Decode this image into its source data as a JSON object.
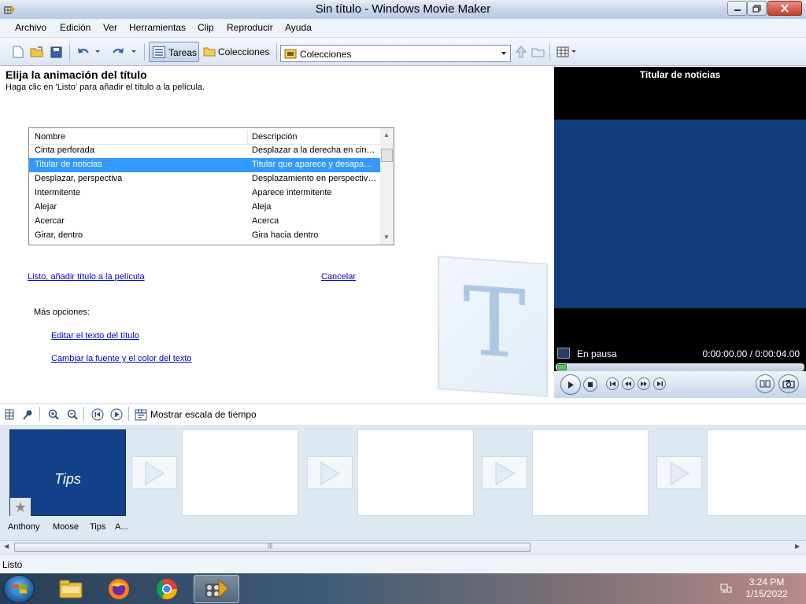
{
  "window": {
    "title": "Sin título - Windows Movie Maker"
  },
  "menu": [
    "Archivo",
    "Edición",
    "Ver",
    "Herramientas",
    "Clip",
    "Reproducir",
    "Ayuda"
  ],
  "toolbar": {
    "tareas_label": "Tareas",
    "colecciones_label": "Colecciones",
    "collection_selected": "Colecciones"
  },
  "task": {
    "title": "Elija la animación del título",
    "subtitle": "Haga clic en 'Listo' para añadir el título a la película.",
    "columns": [
      "Nombre",
      "Descripción"
    ],
    "rows": [
      {
        "name": "Cinta perforada",
        "desc": "Desplazar a la derecha en cin…"
      },
      {
        "name": "Titular de noticias",
        "desc": "Titular que aparece y desapa…",
        "selected": true
      },
      {
        "name": "Desplazar, perspectiva",
        "desc": "Desplazamiento en perspectiv…"
      },
      {
        "name": "Intermitente",
        "desc": "Aparece intermitente"
      },
      {
        "name": "Alejar",
        "desc": "Aleja"
      },
      {
        "name": "Acercar",
        "desc": "Acerca"
      },
      {
        "name": "Girar, dentro",
        "desc": "Gira hacia dentro"
      }
    ],
    "done_link": "Listo, añadir título a la película",
    "cancel_link": "Cancelar",
    "more_options": "Más opciones:",
    "edit_text_link": "Editar el texto del título",
    "change_font_link": "Cambiar la fuente y el color del texto"
  },
  "monitor": {
    "title": "Titular de noticias",
    "status": "En pausa",
    "time": "0:00:00.00 / 0:00:04.00",
    "progress": 0
  },
  "storyboard": {
    "show_timeline_label": "Mostrar escala de tiempo",
    "clip_text": "Tips",
    "captions": [
      "Anthony",
      "Moose",
      "Tips",
      "A..."
    ]
  },
  "status": "Listo",
  "clock": {
    "time": "3:24 PM",
    "date": "1/15/2022"
  },
  "colors": {
    "accent_selection": "#3399ff",
    "monitor_screen": "#113d7e",
    "clip_fill": "#12418a",
    "link": "#0000cc"
  }
}
